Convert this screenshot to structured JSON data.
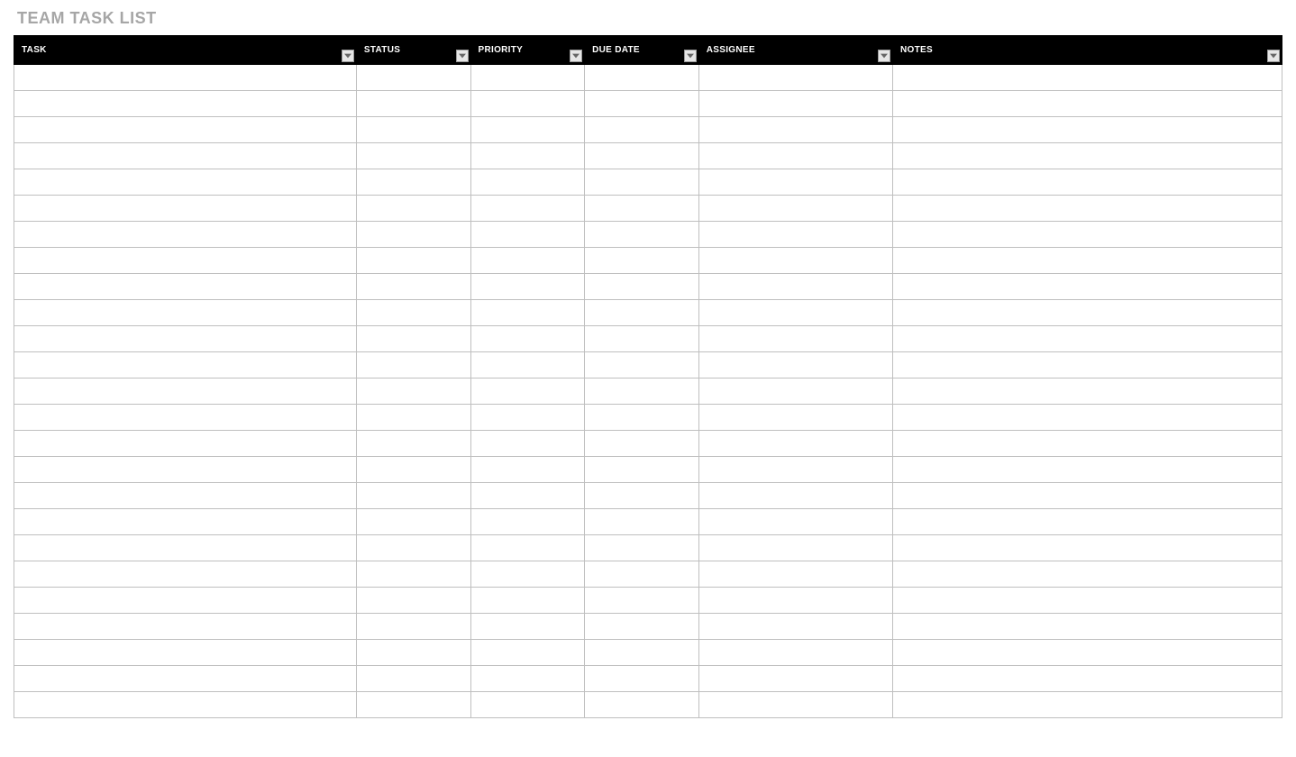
{
  "title": "TEAM TASK LIST",
  "columns": [
    {
      "label": "TASK",
      "filter": true
    },
    {
      "label": "STATUS",
      "filter": true
    },
    {
      "label": "PRIORITY",
      "filter": true
    },
    {
      "label": "DUE DATE",
      "filter": true
    },
    {
      "label": "ASSIGNEE",
      "filter": true
    },
    {
      "label": "NOTES",
      "filter": true
    }
  ],
  "rows": [
    {
      "task": "",
      "status": "",
      "priority": "",
      "duedate": "",
      "assignee": "",
      "notes": ""
    },
    {
      "task": "",
      "status": "",
      "priority": "",
      "duedate": "",
      "assignee": "",
      "notes": ""
    },
    {
      "task": "",
      "status": "",
      "priority": "",
      "duedate": "",
      "assignee": "",
      "notes": ""
    },
    {
      "task": "",
      "status": "",
      "priority": "",
      "duedate": "",
      "assignee": "",
      "notes": ""
    },
    {
      "task": "",
      "status": "",
      "priority": "",
      "duedate": "",
      "assignee": "",
      "notes": ""
    },
    {
      "task": "",
      "status": "",
      "priority": "",
      "duedate": "",
      "assignee": "",
      "notes": ""
    },
    {
      "task": "",
      "status": "",
      "priority": "",
      "duedate": "",
      "assignee": "",
      "notes": ""
    },
    {
      "task": "",
      "status": "",
      "priority": "",
      "duedate": "",
      "assignee": "",
      "notes": ""
    },
    {
      "task": "",
      "status": "",
      "priority": "",
      "duedate": "",
      "assignee": "",
      "notes": ""
    },
    {
      "task": "",
      "status": "",
      "priority": "",
      "duedate": "",
      "assignee": "",
      "notes": ""
    },
    {
      "task": "",
      "status": "",
      "priority": "",
      "duedate": "",
      "assignee": "",
      "notes": ""
    },
    {
      "task": "",
      "status": "",
      "priority": "",
      "duedate": "",
      "assignee": "",
      "notes": ""
    },
    {
      "task": "",
      "status": "",
      "priority": "",
      "duedate": "",
      "assignee": "",
      "notes": ""
    },
    {
      "task": "",
      "status": "",
      "priority": "",
      "duedate": "",
      "assignee": "",
      "notes": ""
    },
    {
      "task": "",
      "status": "",
      "priority": "",
      "duedate": "",
      "assignee": "",
      "notes": ""
    },
    {
      "task": "",
      "status": "",
      "priority": "",
      "duedate": "",
      "assignee": "",
      "notes": ""
    },
    {
      "task": "",
      "status": "",
      "priority": "",
      "duedate": "",
      "assignee": "",
      "notes": ""
    },
    {
      "task": "",
      "status": "",
      "priority": "",
      "duedate": "",
      "assignee": "",
      "notes": ""
    },
    {
      "task": "",
      "status": "",
      "priority": "",
      "duedate": "",
      "assignee": "",
      "notes": ""
    },
    {
      "task": "",
      "status": "",
      "priority": "",
      "duedate": "",
      "assignee": "",
      "notes": ""
    },
    {
      "task": "",
      "status": "",
      "priority": "",
      "duedate": "",
      "assignee": "",
      "notes": ""
    },
    {
      "task": "",
      "status": "",
      "priority": "",
      "duedate": "",
      "assignee": "",
      "notes": ""
    },
    {
      "task": "",
      "status": "",
      "priority": "",
      "duedate": "",
      "assignee": "",
      "notes": ""
    },
    {
      "task": "",
      "status": "",
      "priority": "",
      "duedate": "",
      "assignee": "",
      "notes": ""
    },
    {
      "task": "",
      "status": "",
      "priority": "",
      "duedate": "",
      "assignee": "",
      "notes": ""
    }
  ]
}
